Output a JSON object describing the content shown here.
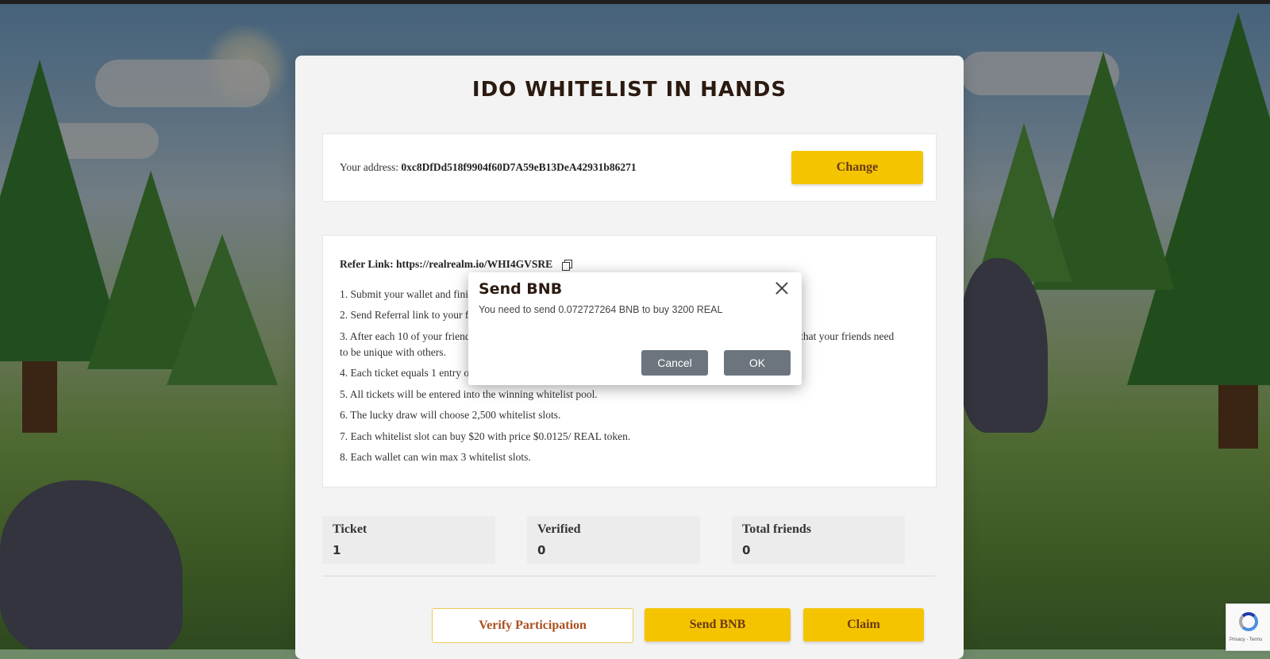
{
  "page": {
    "title": "IDO WHITELIST IN HANDS"
  },
  "address_panel": {
    "label": "Your address: ",
    "address": "0xc8DfDd518f9904f60D7A59eB13DeA42931b86271",
    "change_label": "Change"
  },
  "refer_panel": {
    "refer_label": "Refer Link: https://realrealm.io/WHI4GVSRE",
    "rules": [
      "1. Submit your wallet and fini",
      "2. Send Referral link to your f",
      "3. After each 10 of your friend",
      "mind that your friends need",
      "to be unique with others.",
      "4. Each ticket equals 1 entry o",
      "5. All tickets will be entered into the winning whitelist pool.",
      "6. The lucky draw will choose 2,500 whitelist slots.",
      "7. Each whitelist slot can buy $20 with price $0.0125/ REAL token.",
      "8. Each wallet can win max 3 whitelist slots."
    ]
  },
  "stats": [
    {
      "label": "Ticket",
      "value": "1"
    },
    {
      "label": "Verified",
      "value": "0"
    },
    {
      "label": "Total friends",
      "value": "0"
    }
  ],
  "actions": {
    "verify_label": "Verify Participation",
    "send_label": "Send BNB",
    "claim_label": "Claim"
  },
  "dialog": {
    "title": "Send BNB",
    "message": "You need to send 0.072727264 BNB to buy 3200 REAL",
    "cancel_label": "Cancel",
    "ok_label": "OK"
  },
  "recaptcha": {
    "footer": "Privacy - Terms"
  },
  "colors": {
    "accent_yellow": "#f5c400",
    "dialog_button": "#6c757d",
    "title_brown": "#2b1a10"
  },
  "icons": {
    "copy": "copy-icon",
    "close": "close-icon"
  }
}
